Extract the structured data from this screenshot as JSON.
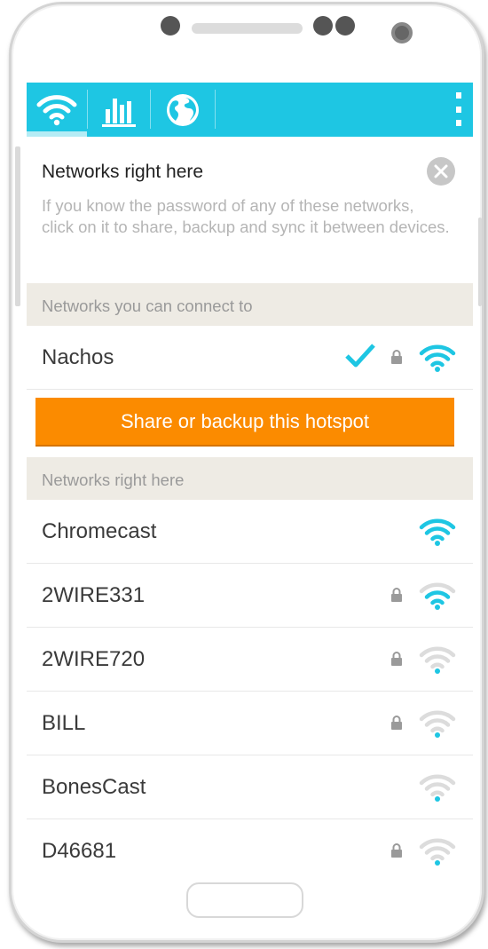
{
  "tabs": [
    {
      "icon": "wifi-icon",
      "active": true
    },
    {
      "icon": "bar-chart-icon",
      "active": false
    },
    {
      "icon": "globe-icon",
      "active": false
    }
  ],
  "info": {
    "title": "Networks right here",
    "description": "If you know the password of any of these networks, click on it to share, backup and sync it between devices."
  },
  "connectable_section": {
    "header": "Networks you can connect to",
    "networks": [
      {
        "name": "Nachos",
        "connected": true,
        "locked": true,
        "signal": "strong"
      }
    ]
  },
  "share_button_label": "Share or backup this hotspot",
  "nearby_section": {
    "header": "Networks right here",
    "networks": [
      {
        "name": "Chromecast",
        "locked": false,
        "signal": "full"
      },
      {
        "name": "2WIRE331",
        "locked": true,
        "signal": "medium"
      },
      {
        "name": "2WIRE720",
        "locked": true,
        "signal": "weak"
      },
      {
        "name": "BILL",
        "locked": true,
        "signal": "weak"
      },
      {
        "name": "BonesCast",
        "locked": false,
        "signal": "weak"
      },
      {
        "name": "D46681",
        "locked": true,
        "signal": "weak"
      }
    ]
  },
  "colors": {
    "accent": "#1ec6e3",
    "action": "#fb8b00",
    "section_bg": "#eeebe4",
    "muted_text": "#b5b5b5"
  }
}
